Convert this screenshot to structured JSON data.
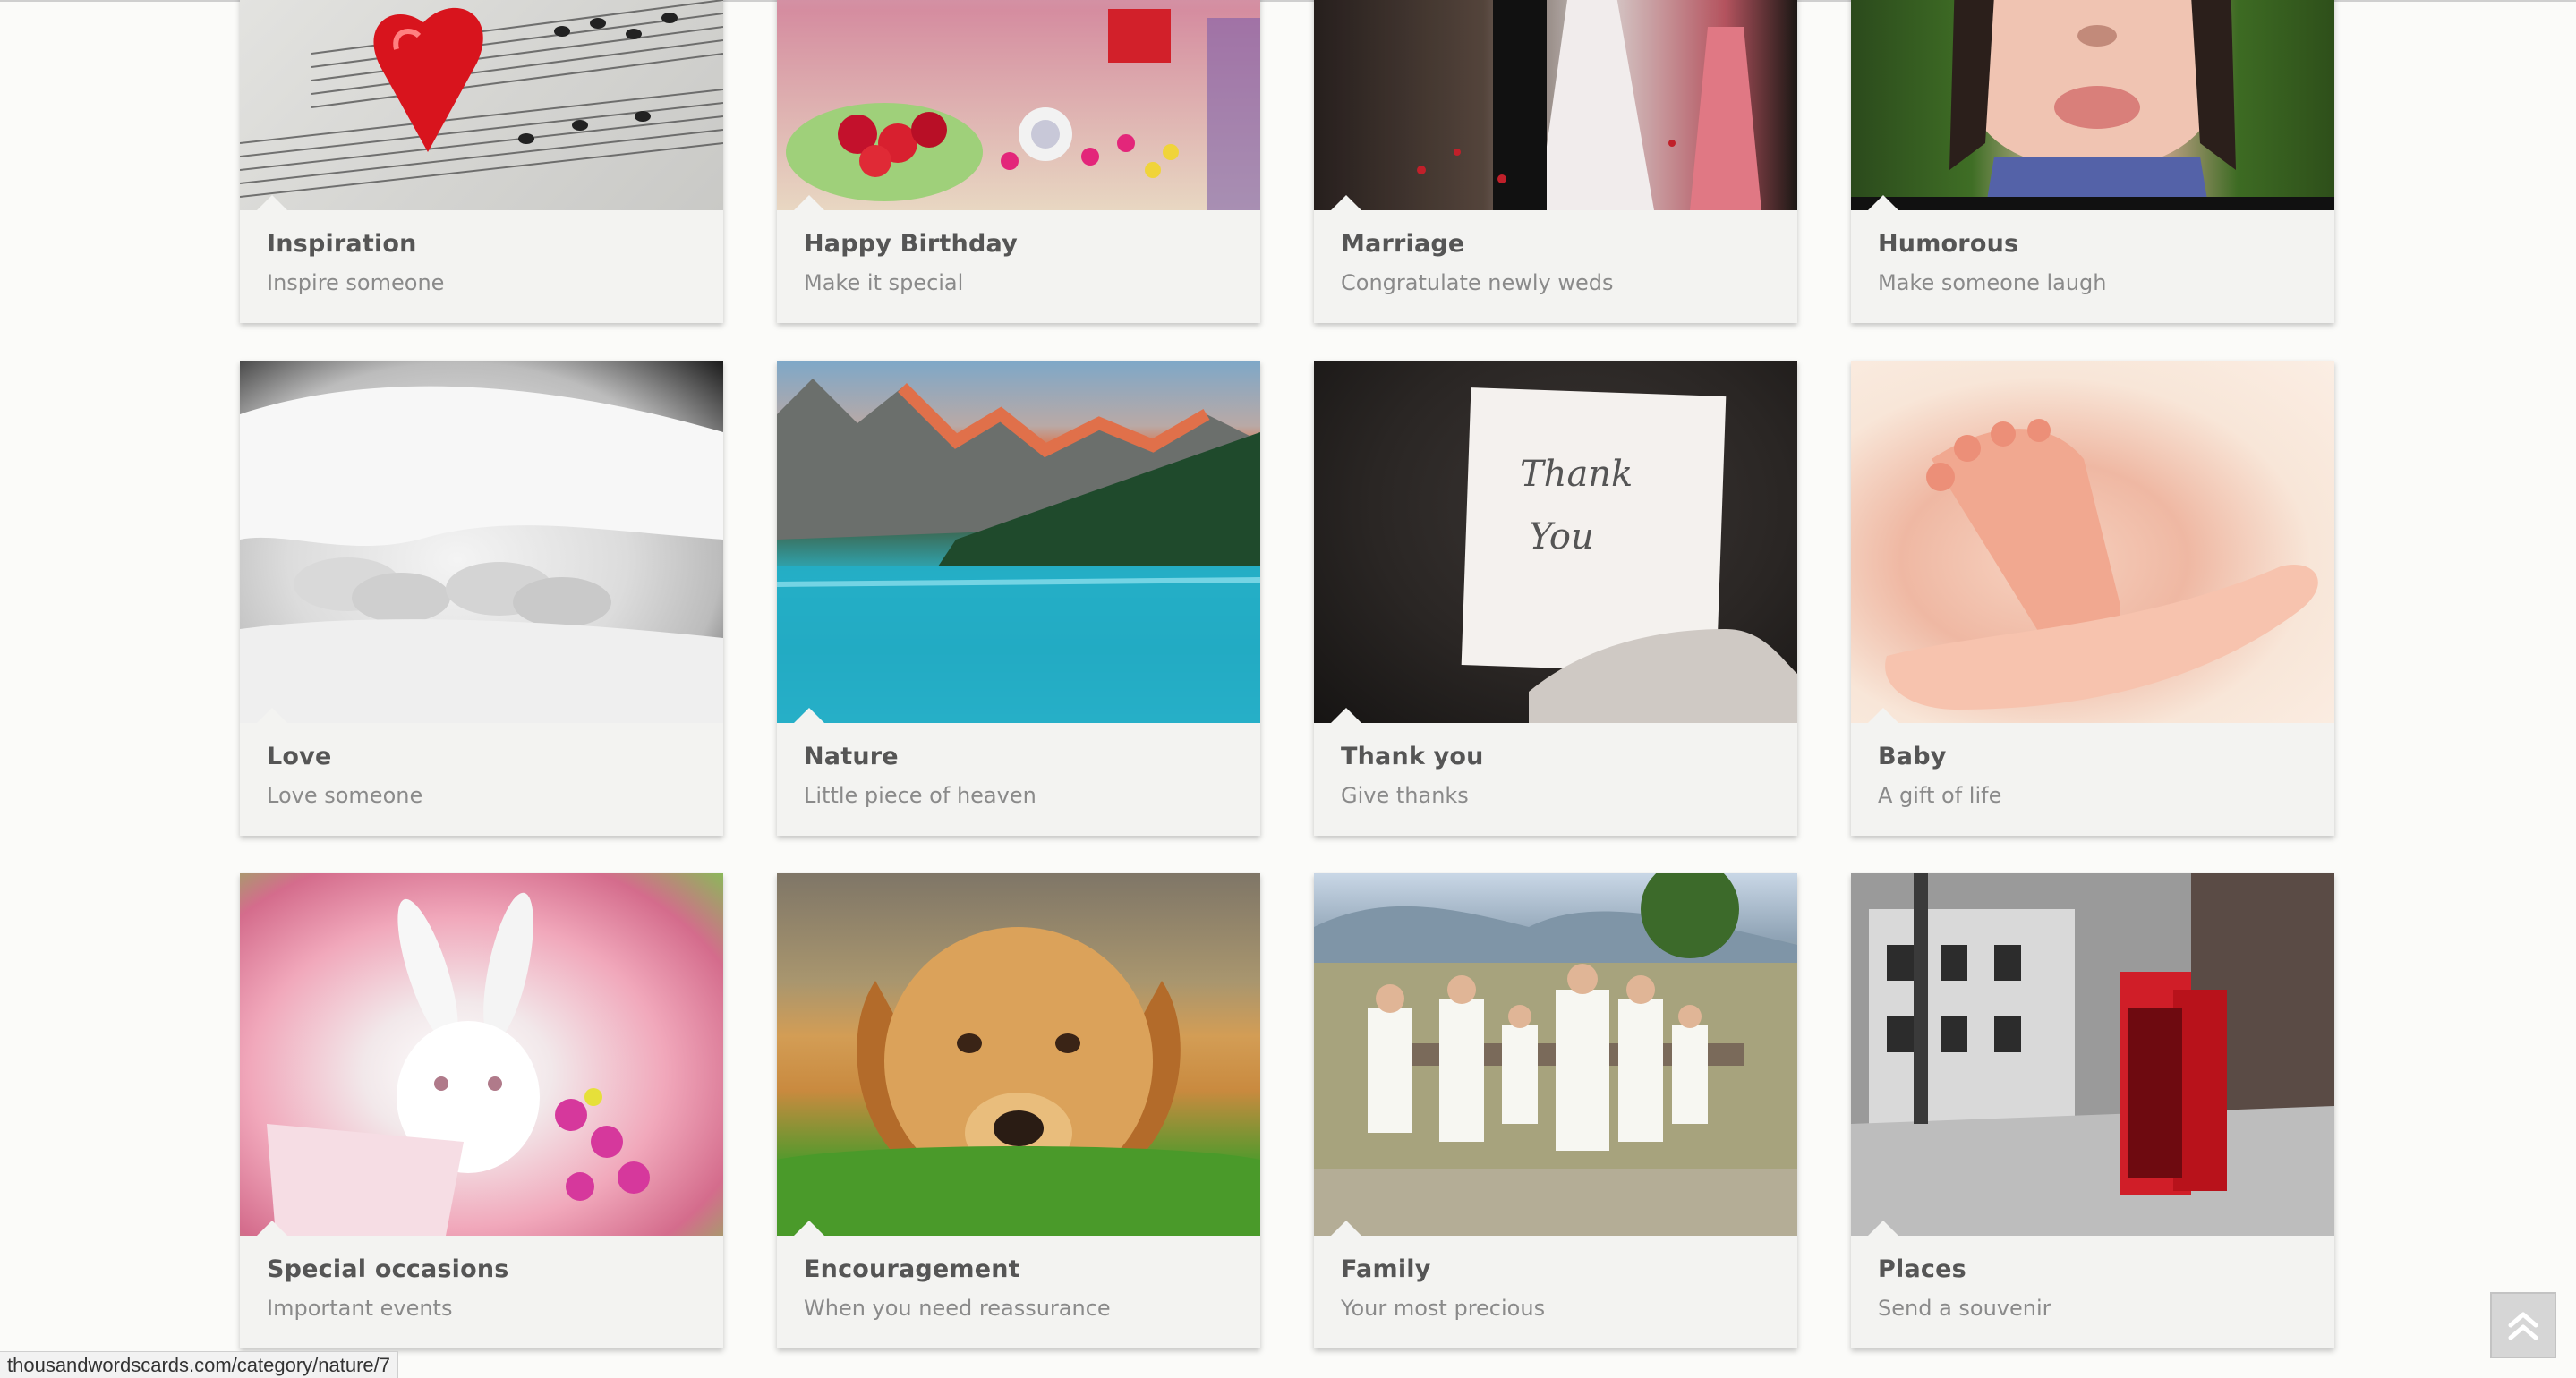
{
  "cards": [
    {
      "title": "Inspiration",
      "subtitle": "Inspire someone",
      "image": "sheet-music-heart-image"
    },
    {
      "title": "Happy Birthday",
      "subtitle": "Make it special",
      "image": "party-candy-table-image"
    },
    {
      "title": "Marriage",
      "subtitle": "Congratulate newly weds",
      "image": "wedding-couple-image"
    },
    {
      "title": "Humorous",
      "subtitle": "Make someone laugh",
      "image": "kissing-face-image"
    },
    {
      "title": "Love",
      "subtitle": "Love someone",
      "image": "feet-under-blanket-image"
    },
    {
      "title": "Nature",
      "subtitle": "Little piece of heaven",
      "image": "mountain-lake-image"
    },
    {
      "title": "Thank you",
      "subtitle": "Give thanks",
      "image": "thank-you-note-image"
    },
    {
      "title": "Baby",
      "subtitle": "A gift of life",
      "image": "baby-foot-in-hand-image"
    },
    {
      "title": "Special occasions",
      "subtitle": "Important events",
      "image": "white-bunny-flowers-image"
    },
    {
      "title": "Encouragement",
      "subtitle": "When you need reassurance",
      "image": "golden-retriever-puppy-image"
    },
    {
      "title": "Family",
      "subtitle": "Your most precious",
      "image": "family-on-bench-image"
    },
    {
      "title": "Places",
      "subtitle": "Send a souvenir",
      "image": "red-phone-booths-image"
    }
  ],
  "image_texts": {
    "thank_you_note": "Thank\nYou"
  },
  "status_bar": {
    "url": "thousandwordscards.com/category/nature/7"
  },
  "back_to_top": {
    "icon": "double-chevron-up-icon"
  }
}
